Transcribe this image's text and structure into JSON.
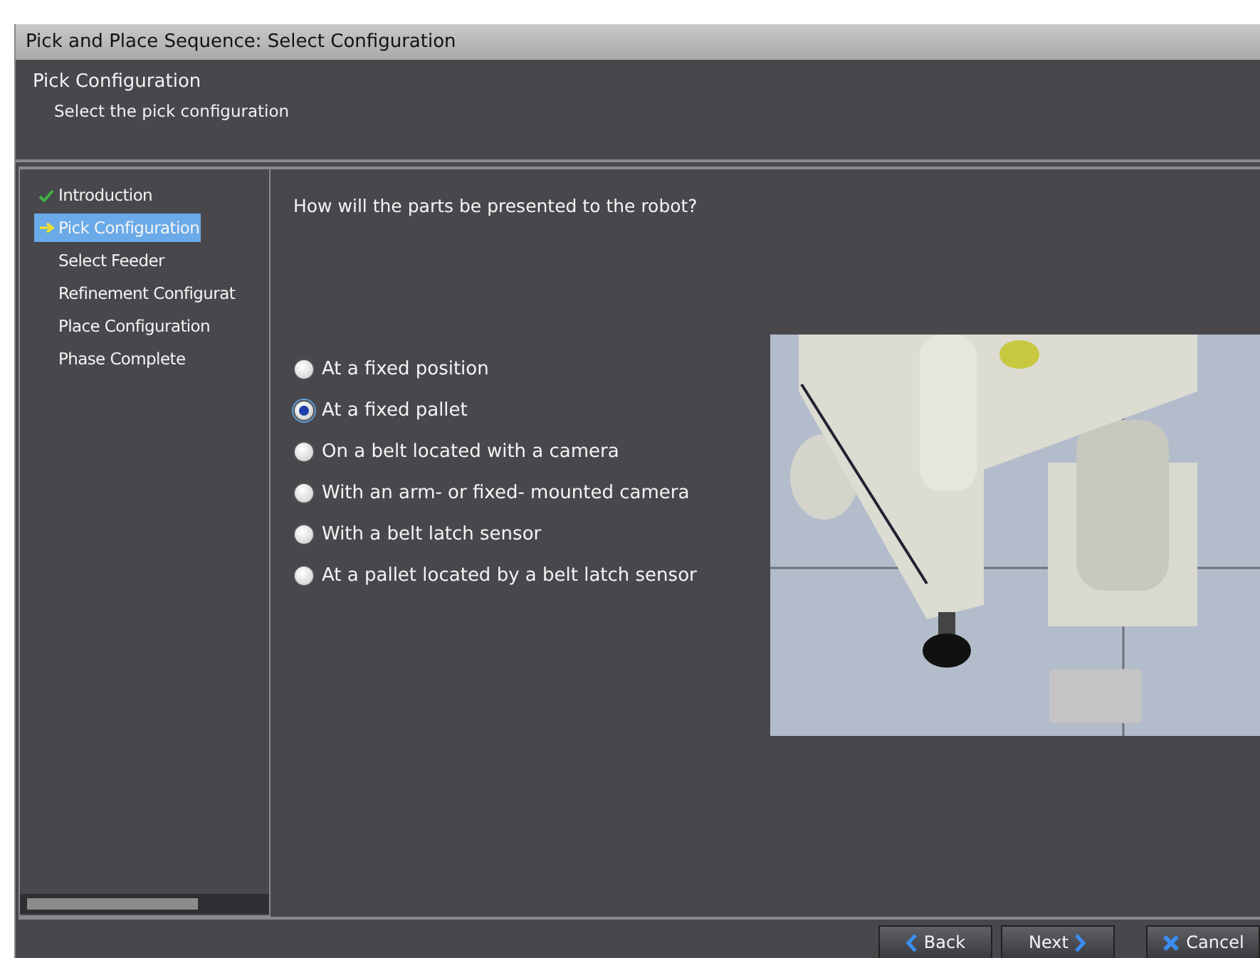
{
  "window": {
    "title": "Pick and Place Sequence: Select Configuration"
  },
  "header": {
    "title": "Pick Configuration",
    "subtitle": "Select the pick configuration"
  },
  "steps": [
    {
      "label": "Introduction",
      "kind": "done",
      "selected": false
    },
    {
      "label": "Pick Configuration",
      "kind": "current",
      "selected": true
    },
    {
      "label": "Select Feeder",
      "kind": "pending",
      "selected": false
    },
    {
      "label": "Refinement Configurat",
      "kind": "pending",
      "selected": false
    },
    {
      "label": "Place Configuration",
      "kind": "pending",
      "selected": false
    },
    {
      "label": "Phase Complete",
      "kind": "pending",
      "selected": false
    }
  ],
  "question": "How will the parts be presented to the robot?",
  "options": [
    {
      "label": "At a fixed position",
      "selected": false
    },
    {
      "label": "At a fixed pallet",
      "selected": true
    },
    {
      "label": "On a belt located with a camera",
      "selected": false
    },
    {
      "label": "With an arm- or fixed- mounted camera",
      "selected": false
    },
    {
      "label": "With a belt latch sensor",
      "selected": false
    },
    {
      "label": "At a pallet located by a belt latch sensor",
      "selected": false
    }
  ],
  "buttons": [
    {
      "label": "Back",
      "kind": "back"
    },
    {
      "label": "Next",
      "kind": "next"
    },
    {
      "label": "Cancel",
      "kind": "cancel"
    }
  ]
}
